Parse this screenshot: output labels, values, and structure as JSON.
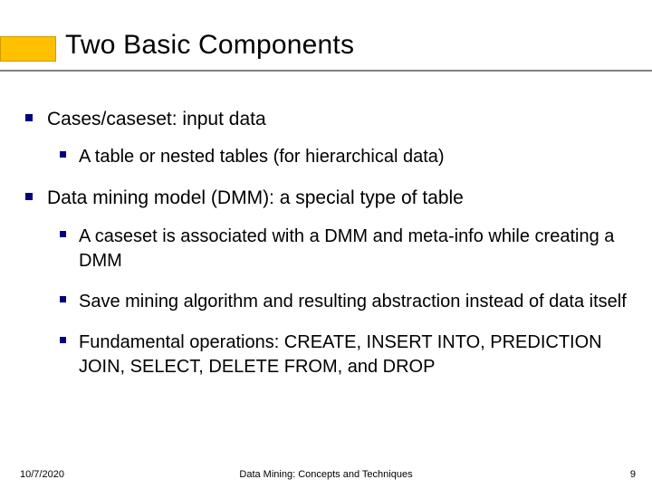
{
  "title": "Two Basic Components",
  "points": [
    {
      "text": "Cases/caseset: input data",
      "sub": [
        "A table or nested tables (for hierarchical data)"
      ]
    },
    {
      "text": "Data mining model (DMM): a special type of table",
      "sub": [
        "A caseset is associated with a DMM and meta-info while creating a DMM",
        "Save mining algorithm and resulting abstraction instead of data itself",
        "Fundamental operations: CREATE, INSERT INTO, PREDICTION JOIN, SELECT, DELETE FROM, and DROP"
      ]
    }
  ],
  "footer": {
    "date": "10/7/2020",
    "center": "Data Mining: Concepts and Techniques",
    "page": "9"
  }
}
